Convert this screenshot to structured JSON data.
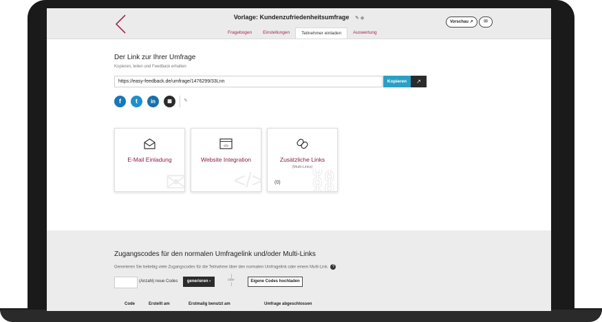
{
  "header": {
    "title": "Vorlage: Kundenzufriedenheitsumfrage",
    "preview_label": "Vorschau",
    "tabs": [
      "Fragebogen",
      "Einstellungen",
      "Teilnehmer einladen",
      "Auswertung"
    ],
    "active_tab": "Teilnehmer einladen"
  },
  "link_section": {
    "heading": "Der Link zur Ihrer Umfrage",
    "subheading": "Kopieren, teilen und Feedback erhalten",
    "url": "https://easy-feedback.de/umfrage/1476299/33Lnn",
    "copy_label": "Kopieren"
  },
  "social": {
    "facebook": "f",
    "twitter": "t",
    "linkedin": "in"
  },
  "cards": [
    {
      "title": "E-Mail Einladung",
      "icon": "envelope-icon"
    },
    {
      "title": "Website Integration",
      "icon": "code-window-icon"
    },
    {
      "title": "Zusätzliche Links",
      "subtitle": "(Multi-Links)",
      "count": "(0)",
      "icon": "link-icon"
    }
  ],
  "codes_section": {
    "heading": "Zugangscodes für den normalen Umfragelink und/oder Multi-Links",
    "description": "Generieren Sie beliebig viele Zugangscodes für die Teilnahme über den normalen Umfragelink oder einem Multi-Link.",
    "count_label": "(Anzahl) neue Codes",
    "generate_label": "generieren",
    "or_label": "oder",
    "upload_label": "Eigene Codes hochladen",
    "table_headers": [
      "Code",
      "Erstellt am",
      "Erstmalig benutzt am",
      "Umfrage abgeschlossen"
    ]
  },
  "colors": {
    "accent": "#a3284e",
    "copy_button": "#2aa0c6",
    "dark_button": "#2b2b2b"
  }
}
